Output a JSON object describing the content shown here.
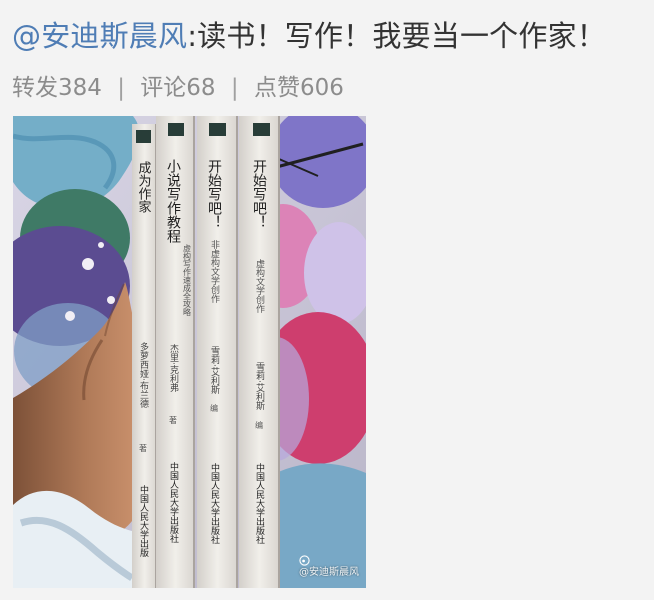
{
  "post": {
    "mention": "@安迪斯晨风",
    "body": ":读书！写作！我要当一个作家！"
  },
  "stats": {
    "repost": "转发384",
    "comment": "评论68",
    "like": "点赞606",
    "separator": "|"
  },
  "photo": {
    "books": [
      {
        "title": "成为作家",
        "author": "多萝西娅·布兰德",
        "role": "著",
        "publisher": "中国人民大学出版"
      },
      {
        "title": "小说写作教程",
        "subtitle": "虚构写作速成全攻略",
        "author": "杰里·克利弗",
        "role": "著",
        "publisher": "中国人民大学出版社"
      },
      {
        "title": "开始写吧！",
        "subtitle": "非虚构文学创作",
        "author": "雪莉·艾利斯",
        "role": "编",
        "publisher": "中国人民大学出版社"
      },
      {
        "title": "开始写吧！",
        "subtitle": "虚构文学创作",
        "author": "雪莉·艾利斯",
        "role": "编",
        "publisher": "中国人民大学出版社"
      }
    ],
    "watermark": "@安迪斯晨风"
  },
  "colors": {
    "mention": "#4f7db5",
    "text": "#333333",
    "muted": "#8c8c8c",
    "background": "#f3f3f3"
  },
  "icons": {
    "watermark_icon": "weibo-icon"
  }
}
